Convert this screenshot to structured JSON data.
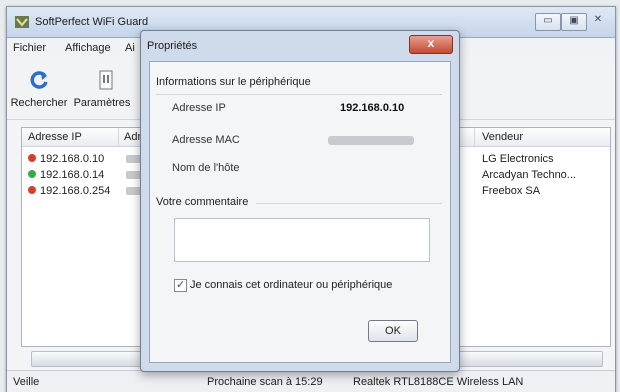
{
  "app": {
    "title": "SoftPerfect WiFi Guard",
    "window_controls": {
      "minimize": "▭",
      "maximize": "▣",
      "close": "✕"
    }
  },
  "menu": {
    "file": "Fichier",
    "view": "Affichage",
    "partial": "Ai"
  },
  "toolbar": {
    "search_label": "Rechercher",
    "settings_label": "Paramètres"
  },
  "list": {
    "headers": {
      "ip": "Adresse IP",
      "mac_partial": "Adr",
      "vendor": "Vendeur"
    },
    "rows": [
      {
        "ip": "192.168.0.10",
        "vendor": "LG Electronics",
        "status_color": "#d4412c"
      },
      {
        "ip": "192.168.0.14",
        "vendor": "Arcadyan Techno...",
        "status_color": "#3aa845"
      },
      {
        "ip": "192.168.0.254",
        "vendor": "Freebox SA",
        "status_color": "#d4412c"
      }
    ]
  },
  "status": {
    "state": "Veille",
    "next_scan": "Prochaine scan à 15:29",
    "adapter": "Realtek RTL8188CE Wireless LAN"
  },
  "dialog": {
    "title": "Propriétés",
    "close_glyph": "x",
    "device_section": "Informations sur le périphérique",
    "ip_label": "Adresse IP",
    "ip_value": "192.168.0.10",
    "mac_label": "Adresse MAC",
    "host_label": "Nom de l'hôte",
    "comment_section": "Votre commentaire",
    "comment_value": "",
    "checkbox_label": "Je connais cet ordinateur ou périphérique",
    "checkbox_checked": true,
    "ok_label": "OK"
  },
  "colors": {
    "accent": "#2a6fc9",
    "close_red": "#c24a33"
  }
}
